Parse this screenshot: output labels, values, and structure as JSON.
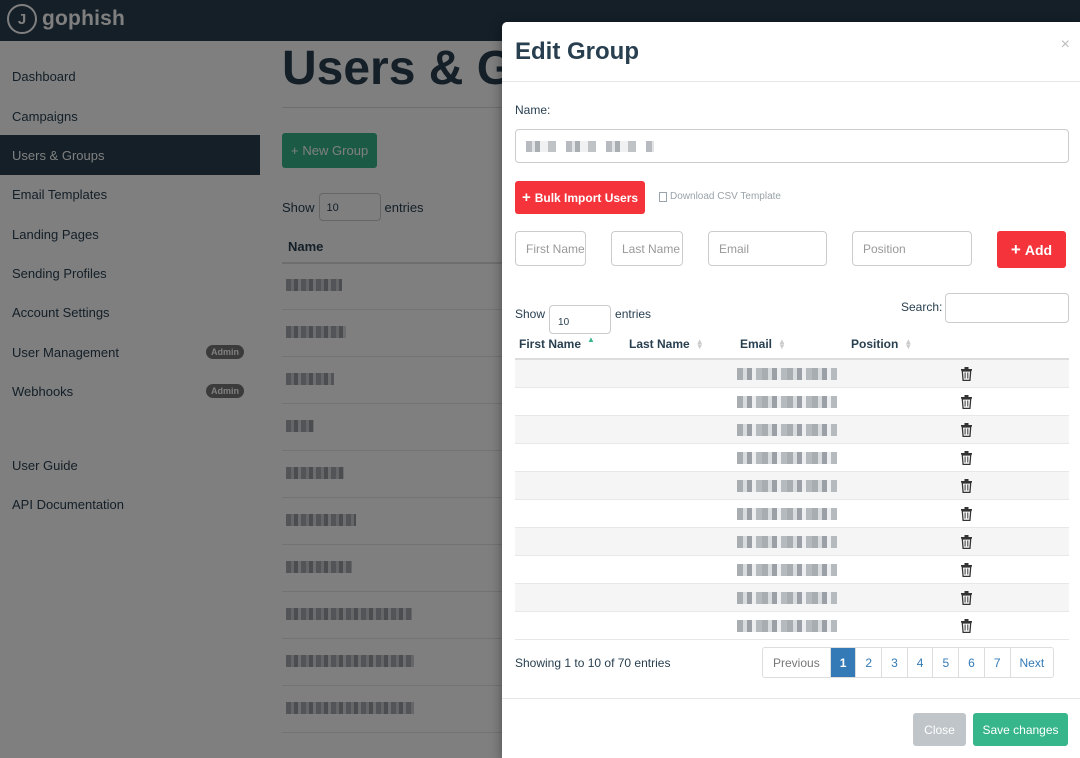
{
  "app": {
    "logo_text": "gophish"
  },
  "sidebar": {
    "items": [
      {
        "label": "Dashboard"
      },
      {
        "label": "Campaigns"
      },
      {
        "label": "Users & Groups"
      },
      {
        "label": "Email Templates"
      },
      {
        "label": "Landing Pages"
      },
      {
        "label": "Sending Profiles"
      },
      {
        "label": "Account Settings"
      },
      {
        "label": "User Management",
        "badge": "Admin"
      },
      {
        "label": "Webhooks",
        "badge": "Admin"
      },
      {
        "label": "User Guide"
      },
      {
        "label": "API Documentation"
      }
    ],
    "active_index": 2
  },
  "main": {
    "title": "Users & G",
    "new_group_label": "New Group",
    "show_label": "Show",
    "show_value": "10",
    "entries_label": "entries",
    "name_col": "Name"
  },
  "modal": {
    "title": "Edit Group",
    "close_glyph": "×",
    "name_label": "Name:",
    "bulk_import_label": "Bulk Import Users",
    "csv_template_label": "Download CSV Template",
    "first_name_placeholder": "First Name",
    "last_name_placeholder": "Last Name",
    "email_placeholder": "Email",
    "position_placeholder": "Position",
    "add_label": "Add",
    "show_label": "Show",
    "show_value": "10",
    "entries_label": "entries",
    "search_label": "Search:",
    "columns": [
      "First Name",
      "Last Name",
      "Email",
      "Position"
    ],
    "info": "Showing 1 to 10 of 70 entries",
    "pagination": {
      "prev": "Previous",
      "pages": [
        "1",
        "2",
        "3",
        "4",
        "5",
        "6",
        "7"
      ],
      "next": "Next",
      "current": "1"
    },
    "close_label": "Close",
    "save_label": "Save changes"
  },
  "colors": {
    "navy": "#283f50",
    "green": "#37b68c",
    "red": "#f4333b",
    "link_blue": "#337ab7"
  }
}
